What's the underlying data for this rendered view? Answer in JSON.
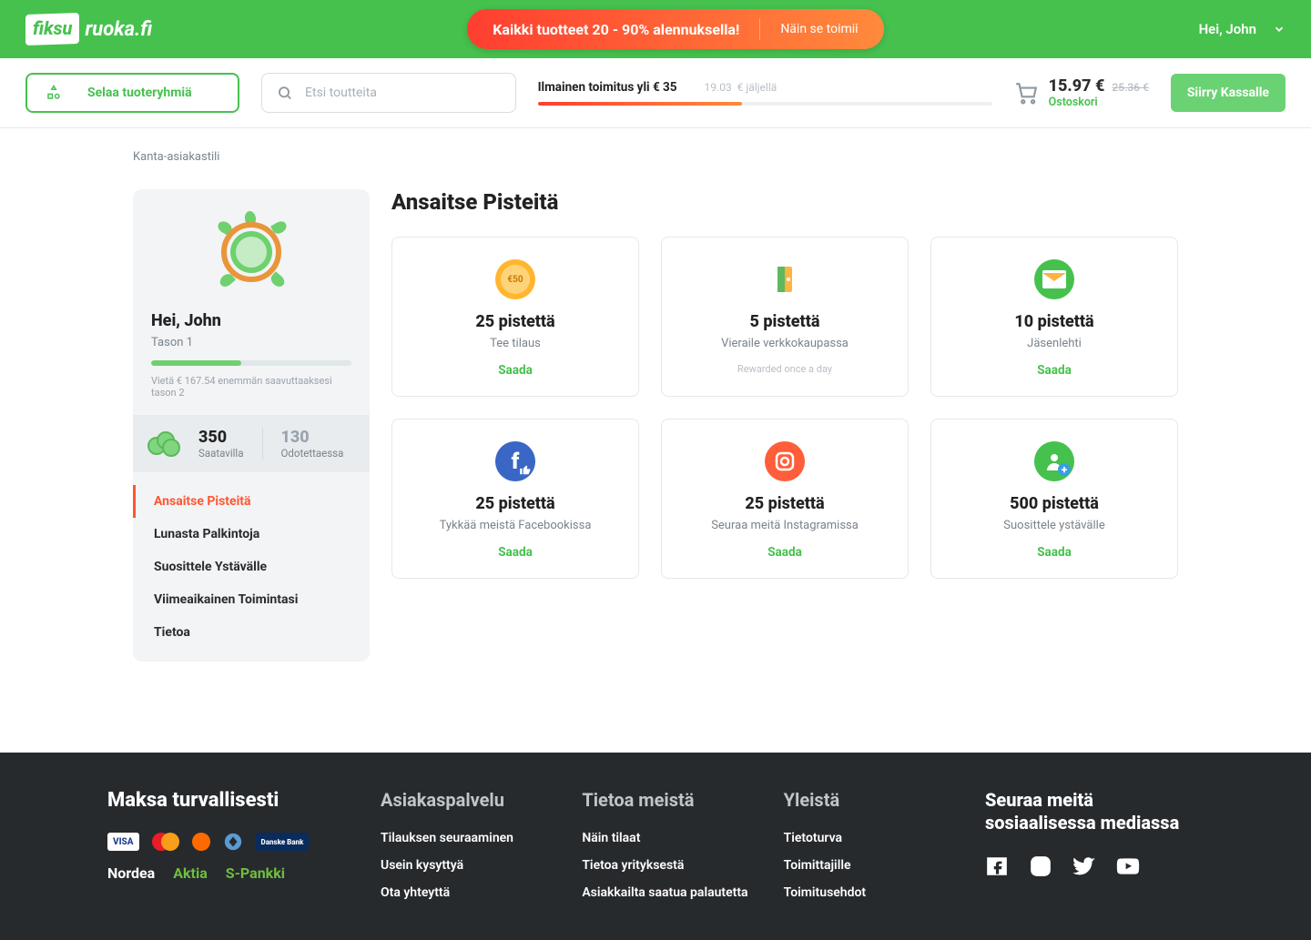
{
  "header": {
    "logo_left": "fiksu",
    "logo_right": "ruoka.fi",
    "promo_main": "Kaikki tuotteet 20 - 90% alennuksella!",
    "promo_sub": "Näin se toimii",
    "greeting": "Hei, John"
  },
  "toolbar": {
    "browse_label": "Selaa tuoteryhmiä",
    "search_placeholder": "Etsi toutteita",
    "free_shipping_label": "Ilmainen toimitus yli € 35",
    "remaining_amount": "19.03",
    "remaining_suffix": "€ jäljellä",
    "cart_total": "15.97 €",
    "cart_original": "25.36 €",
    "cart_label": "Ostoskori",
    "checkout_label": "Siirry Kassalle"
  },
  "breadcrumb": "Kanta-asiakastili",
  "profile": {
    "greeting": "Hei, John",
    "level": "Tason 1",
    "level_hint": "Vietä € 167.54 enemmän saavuttaaksesi tason 2",
    "points_available_num": "350",
    "points_available_label": "Saatavilla",
    "points_pending_num": "130",
    "points_pending_label": "Odotettaessa"
  },
  "nav": {
    "items": [
      {
        "label": "Ansaitse Pisteitä",
        "active": true
      },
      {
        "label": "Lunasta Palkintoja",
        "active": false
      },
      {
        "label": "Suosittele Ystävälle",
        "active": false
      },
      {
        "label": "Viimeaikainen Toimintasi",
        "active": false
      },
      {
        "label": "Tietoa",
        "active": false
      }
    ]
  },
  "page_title": "Ansaitse Pisteitä",
  "cards": [
    {
      "icon": "coin",
      "color": "#ffb62e",
      "points": "25 pistettä",
      "desc": "Tee tilaus",
      "cta": "Saada",
      "icon_text": "€50"
    },
    {
      "icon": "door",
      "color": "#ff8a3c",
      "points": "5 pistettä",
      "desc": "Vieraile verkkokaupassa",
      "cta": "Rewarded once a day",
      "note": true
    },
    {
      "icon": "mail",
      "color": "#46c14e",
      "points": "10 pistettä",
      "desc": "Jäsenlehti",
      "cta": "Saada"
    },
    {
      "icon": "facebook",
      "color": "#3a66c5",
      "points": "25 pistettä",
      "desc": "Tykkää meistä Facebookissa",
      "cta": "Saada"
    },
    {
      "icon": "instagram",
      "color": "#ff5e3a",
      "points": "25 pistettä",
      "desc": "Seuraa meitä Instagramissa",
      "cta": "Saada"
    },
    {
      "icon": "refer",
      "color": "#46c14e",
      "points": "500 pistettä",
      "desc": "Suosittele ystävälle",
      "cta": "Saada"
    }
  ],
  "footer": {
    "pay_title": "Maksa turvallisesti",
    "brands": [
      "Nordea",
      "Aktia",
      "S-Pankki"
    ],
    "cols": [
      {
        "title": "Asiakaspalvelu",
        "links": [
          "Tilauksen seuraaminen",
          "Usein kysyttyä",
          "Ota yhteyttä"
        ]
      },
      {
        "title": "Tietoa meistä",
        "links": [
          "Näin tilaat",
          "Tietoa yrityksestä",
          "Asiakkailta saatua palautetta"
        ]
      },
      {
        "title": "Yleistä",
        "links": [
          "Tietoturva",
          "Toimittajille",
          "Toimitusehdot"
        ]
      }
    ],
    "social_title": "Seuraa meitä sosiaalisessa mediassa"
  }
}
